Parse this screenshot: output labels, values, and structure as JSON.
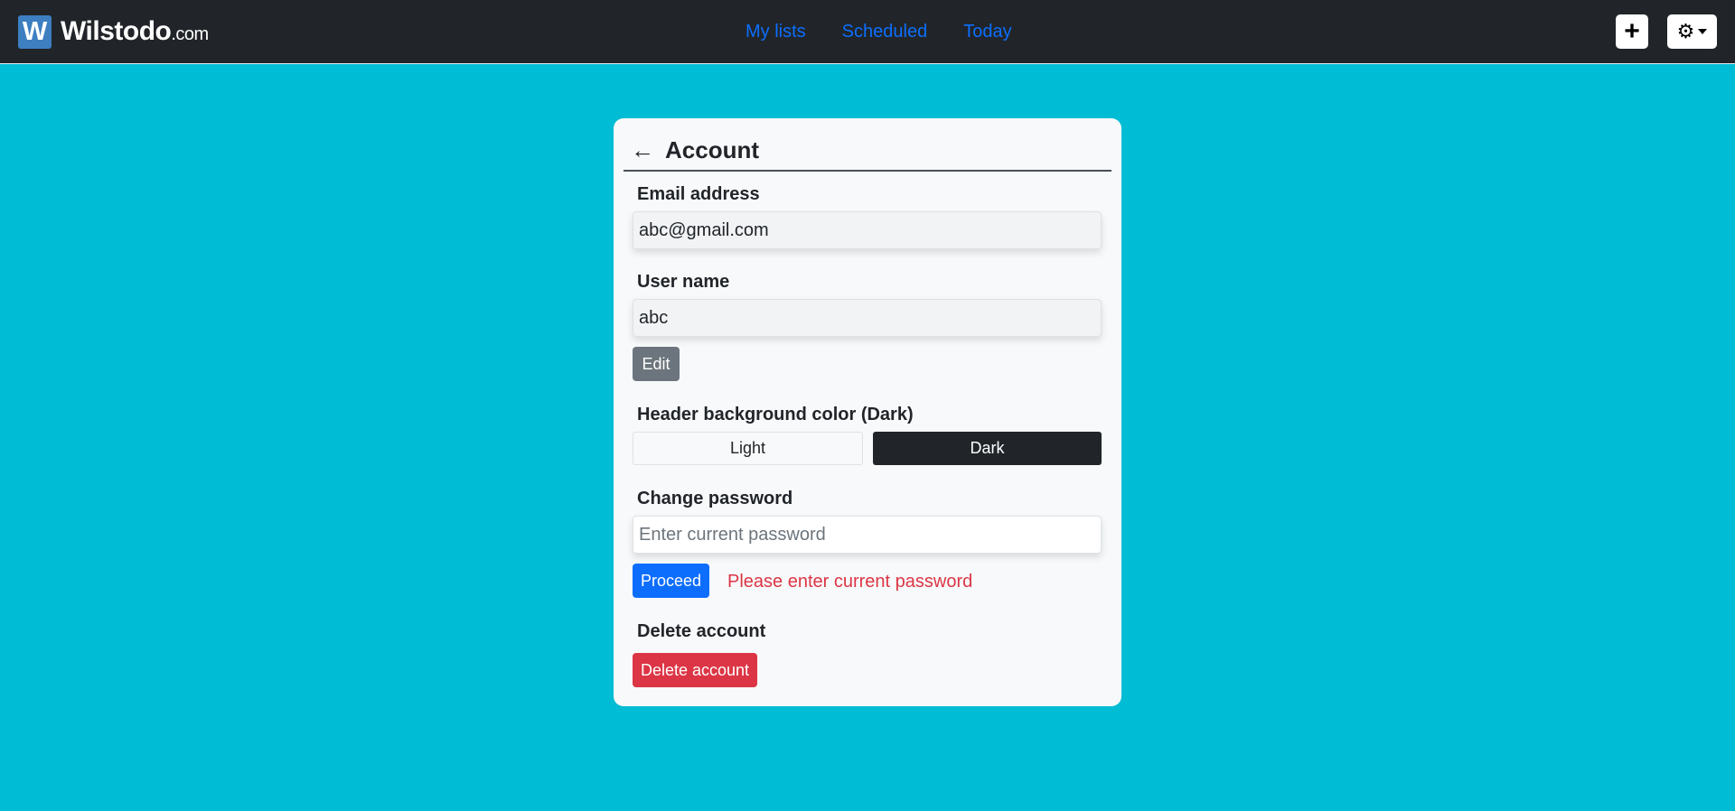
{
  "brand": {
    "logo_letter": "W",
    "name": "Wilstodo",
    "tld": ".com"
  },
  "nav": {
    "links": [
      "My lists",
      "Scheduled",
      "Today"
    ],
    "add_symbol": "+",
    "settings_icon": "gear-icon"
  },
  "account": {
    "title": "Account",
    "email_label": "Email address",
    "email_value": "abc@gmail.com",
    "username_label": "User name",
    "username_value": "abc",
    "edit_button": "Edit",
    "header_color_label": "Header background color (Dark)",
    "toggle_light": "Light",
    "toggle_dark": "Dark",
    "password_label": "Change password",
    "password_placeholder": "Enter current password",
    "proceed_button": "Proceed",
    "password_error": "Please enter current password",
    "delete_label": "Delete account",
    "delete_button": "Delete account"
  },
  "colors": {
    "page_background": "#00bcd4",
    "navbar": "#212529",
    "link": "#0d6efd",
    "danger": "#dc3545",
    "secondary": "#6c757d"
  }
}
